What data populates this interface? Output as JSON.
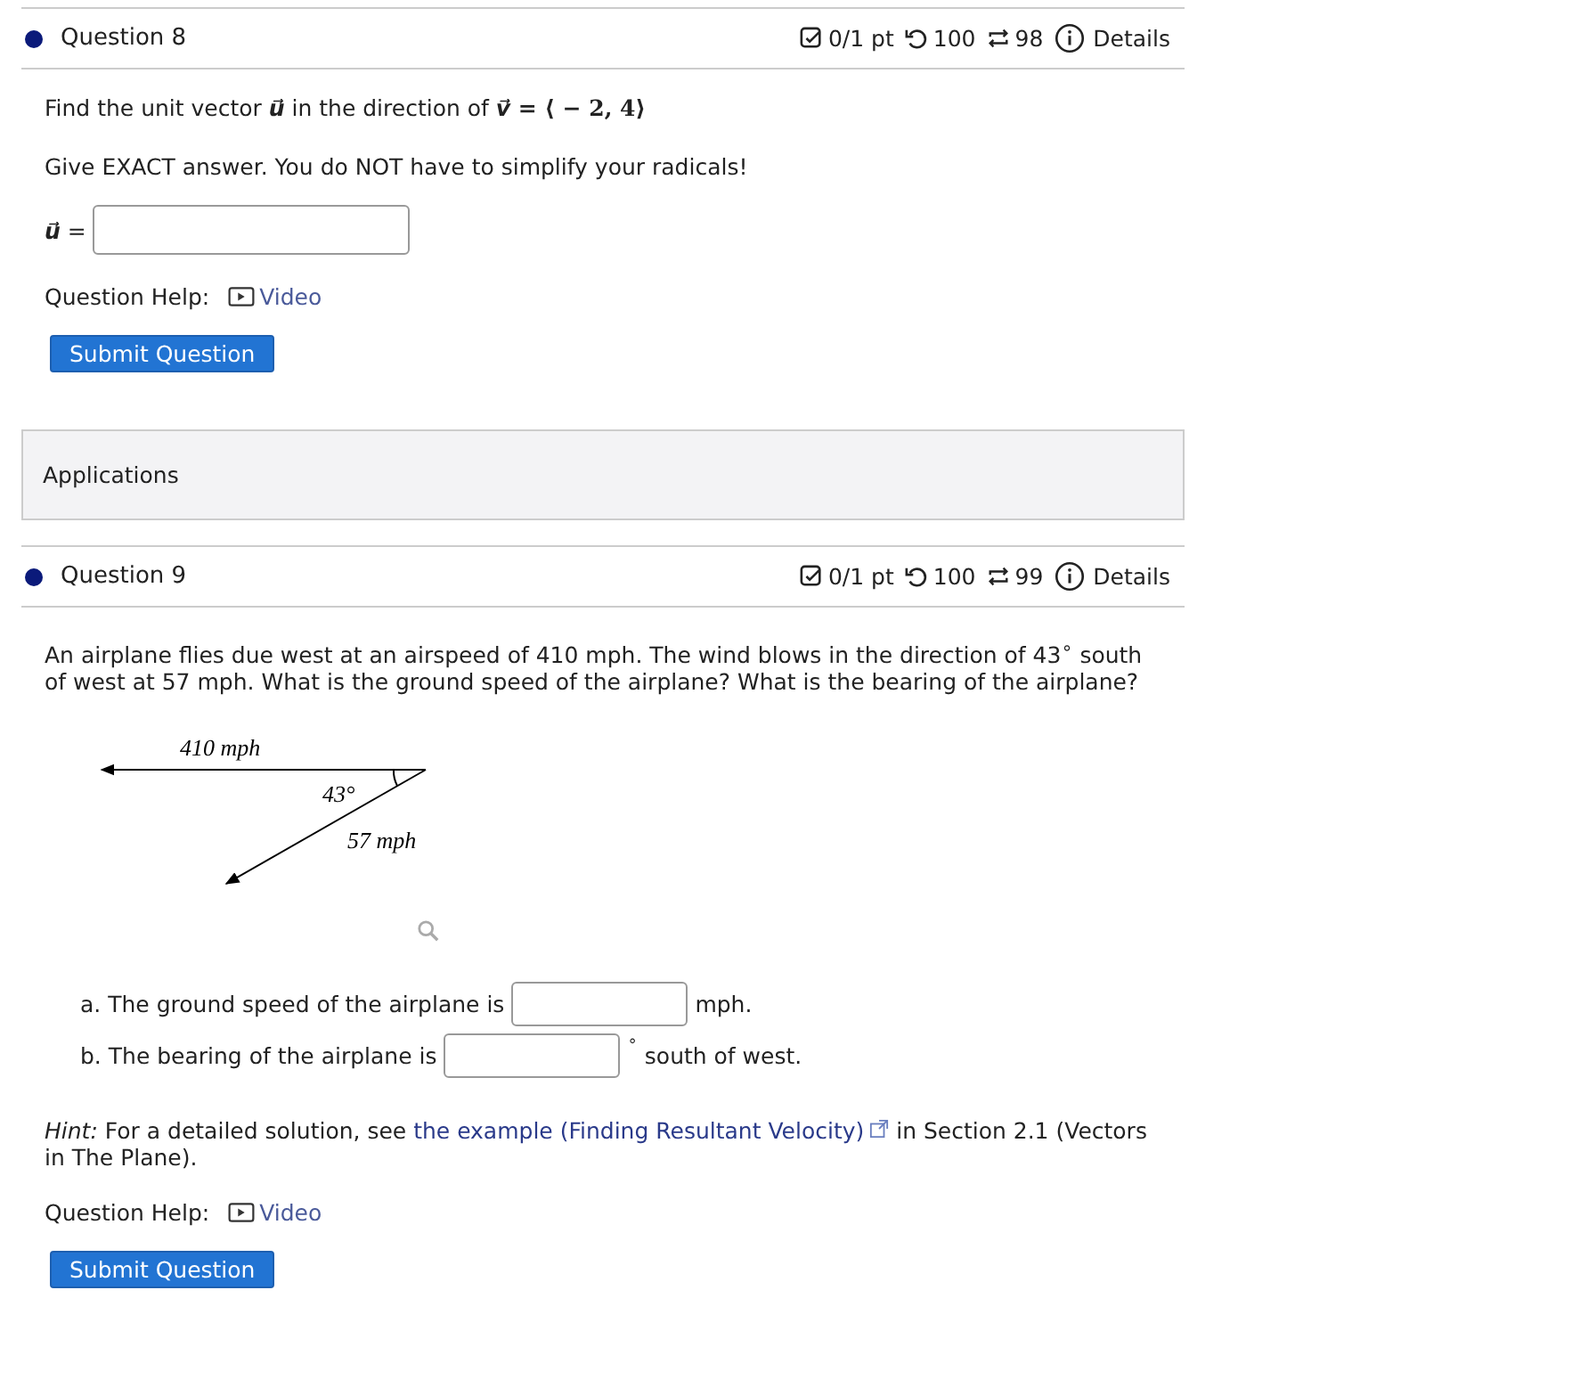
{
  "questions": [
    {
      "title": "Question 8",
      "score": "0/1 pt",
      "retries": "100",
      "attempts": "98",
      "details": "Details",
      "prompt": [
        {
          "kind": "text",
          "text": "Find the unit vector "
        },
        {
          "kind": "math",
          "text": "u⃗"
        },
        {
          "kind": "text",
          "text": " in the direction of "
        },
        {
          "kind": "math",
          "text": "v⃗"
        },
        {
          "kind": "op",
          "text": " = ⟨ − 2, 4⟩"
        }
      ],
      "note": "Give EXACT answer. You do NOT have to simplify your radicals!",
      "answer": {
        "label": "u⃗",
        "eq": "="
      },
      "help_label": "Question Help:",
      "help_link": "Video",
      "submit": "Submit Question"
    }
  ],
  "section": "Applications",
  "question9": {
    "title": "Question 9",
    "score": "0/1 pt",
    "retries": "100",
    "attempts": "99",
    "details": "Details",
    "prompt": "An airplane flies due west at an airspeed of 410 mph. The wind blows in the direction of 43$^{∘}$ south of west at 57 mph. What is the ground speed of the airplane? What is the bearing of the airplane?",
    "diagram": {
      "top_label": "410 mph",
      "angle_label": "43°",
      "side_label": "57 mph"
    },
    "parts": [
      {
        "before": "a. The ground speed of the airplane is",
        "after": "mph."
      },
      {
        "before": "b. The bearing of the airplane is",
        "after": "south of west.",
        "degree": "∘"
      }
    ],
    "hint": {
      "lead": "Hint:",
      "text": " For a detailed solution, see ",
      "link": "the example (Finding Resultant Velocity)",
      "rest": " in Section 2.1 (Vectors in The Plane)."
    },
    "help_label": "Question Help:",
    "help_link": "Video",
    "submit": "Submit Question"
  }
}
